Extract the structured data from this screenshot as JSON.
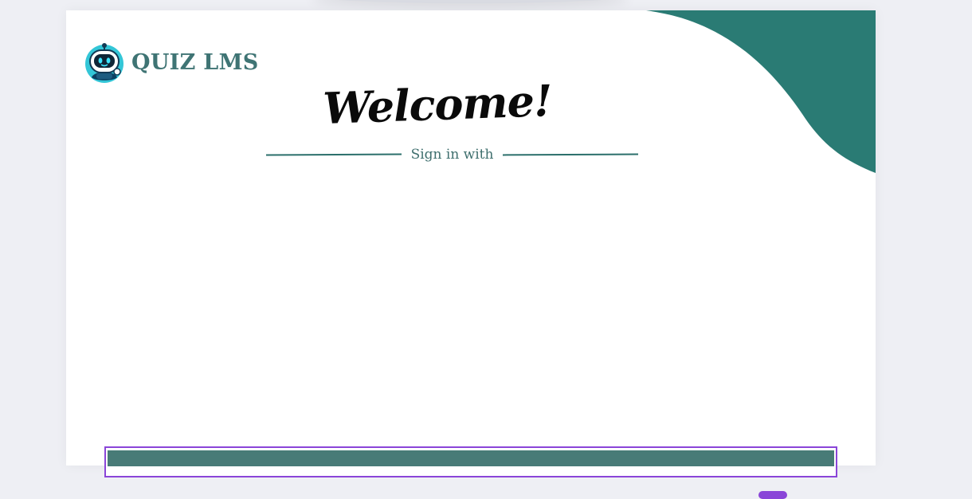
{
  "app": {
    "brand_title": "QUIZ LMS",
    "logo_icon": "robot-mascot-icon"
  },
  "hero": {
    "welcome_text": "Welcome!",
    "signin_label": "Sign in with"
  },
  "colors": {
    "accent_teal": "#2a7b74",
    "brand_text": "#3f7474",
    "bar_fill": "#487b77",
    "focus_outline": "#8a45d8",
    "page_bg": "#eeeff4"
  }
}
